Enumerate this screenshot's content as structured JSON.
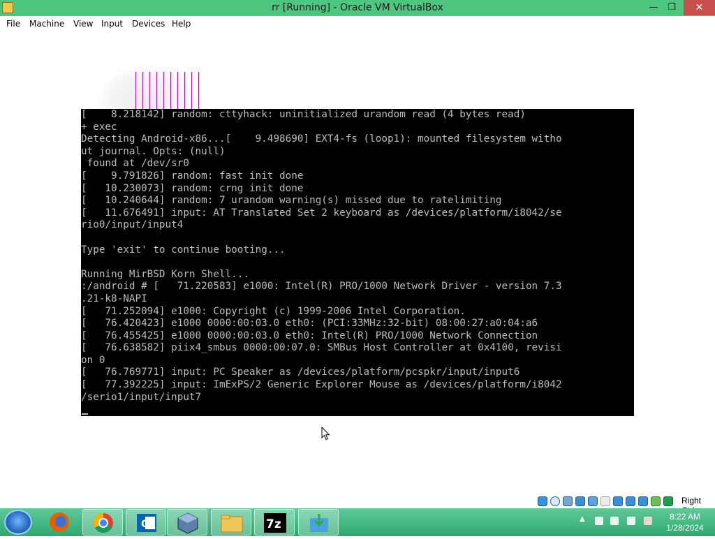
{
  "window": {
    "title": "rr [Running] - Oracle VM VirtualBox",
    "minimize_glyph": "—",
    "maximize_glyph": "❐",
    "close_glyph": "✕"
  },
  "menu": {
    "items": [
      {
        "label": "File"
      },
      {
        "label": "Machine"
      },
      {
        "label": "View"
      },
      {
        "label": "Input"
      },
      {
        "label": "Devices"
      },
      {
        "label": "Help"
      }
    ]
  },
  "console": {
    "lines": [
      "[    8.218142] random: cttyhack: uninitialized urandom read (4 bytes read)",
      "+ exec",
      "Detecting Android-x86...[    9.498690] EXT4-fs (loop1): mounted filesystem witho",
      "ut journal. Opts: (null)",
      " found at /dev/sr0",
      "[    9.791826] random: fast init done",
      "[   10.230073] random: crng init done",
      "[   10.240644] random: 7 urandom warning(s) missed due to ratelimiting",
      "[   11.676491] input: AT Translated Set 2 keyboard as /devices/platform/i8042/se",
      "rio0/input/input4",
      "",
      "Type 'exit' to continue booting...",
      "",
      "Running MirBSD Korn Shell...",
      ":/android # [   71.220583] e1000: Intel(R) PRO/1000 Network Driver - version 7.3",
      ".21-k8-NAPI",
      "[   71.252094] e1000: Copyright (c) 1999-2006 Intel Corporation.",
      "[   76.420423] e1000 0000:00:03.0 eth0: (PCI:33MHz:32-bit) 08:00:27:a0:04:a6",
      "[   76.455425] e1000 0000:00:03.0 eth0: Intel(R) PRO/1000 Network Connection",
      "[   76.638582] piix4_smbus 0000:00:07.0: SMBus Host Controller at 0x4100, revisi",
      "on 0",
      "[   76.769771] input: PC Speaker as /devices/platform/pcspkr/input/input6",
      "[   77.392225] input: ImExPS/2 Generic Explorer Mouse as /devices/platform/i8042",
      "/serio1/input/input7"
    ]
  },
  "status_bar": {
    "host_key": "Right Ctrl",
    "icons": [
      "hard-disk-icon",
      "optical-drive-icon",
      "audio-icon",
      "network-icon",
      "usb-icon",
      "shared-folders-icon",
      "display-icon",
      "video-capture-icon",
      "recording-icon",
      "cpu-icon",
      "mouse-integration-icon",
      "host-key-icon"
    ]
  },
  "taskbar": {
    "apps": [
      "firefox-icon",
      "chrome-icon",
      "outlook-icon",
      "virtualbox-icon",
      "file-explorer-icon",
      "7zip-icon",
      "installer-icon"
    ],
    "tray_arrow": "▲",
    "time": "8:22 AM",
    "date": "1/28/2024"
  }
}
